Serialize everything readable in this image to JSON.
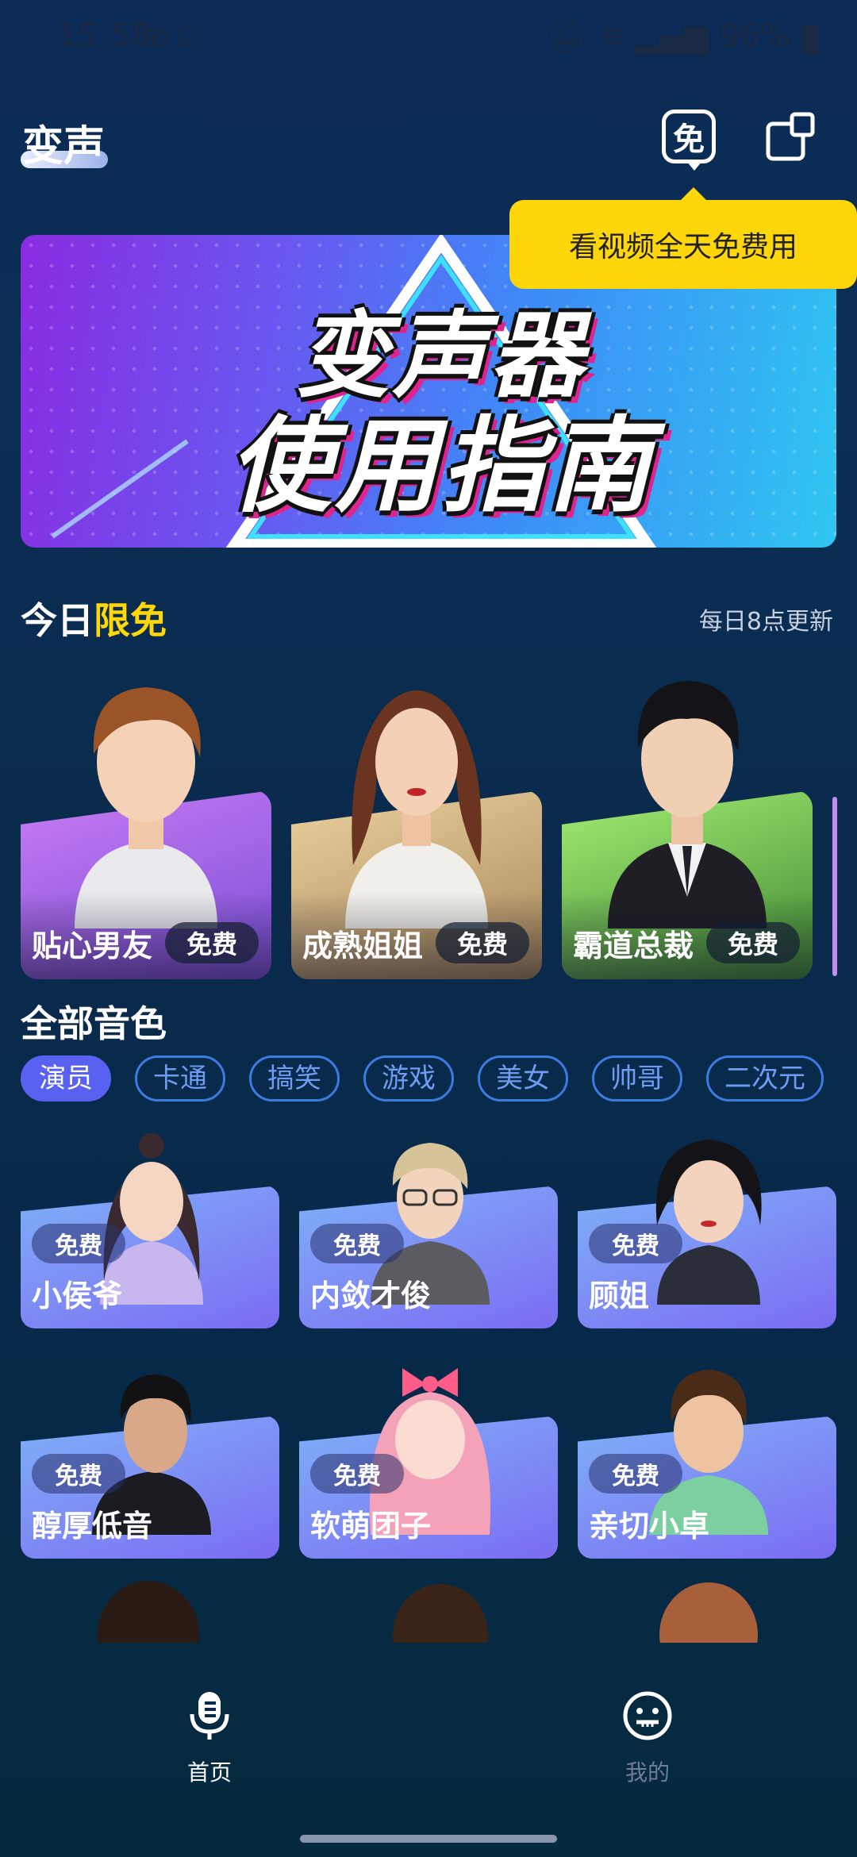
{
  "status_bar": {
    "time": "15:58",
    "battery": "96%",
    "left_icons": [
      "phone-wifi-call-icon",
      "check-box-icon"
    ],
    "right_icons": [
      "mute-icon",
      "wifi-icon",
      "signal-icon",
      "battery-icon"
    ]
  },
  "header": {
    "title": "变声",
    "free_button_label": "免",
    "window_icon": "floating-window-icon"
  },
  "tooltip": {
    "text": "看视频全天免费用"
  },
  "banner": {
    "line1": "变声器",
    "line2": "使用指南"
  },
  "today_section": {
    "title_plain": "今日",
    "title_highlight": "限免",
    "note": "每日8点更新",
    "cards": [
      {
        "name": "贴心男友",
        "badge": "免费",
        "colors": [
          "#b070f0",
          "#7a4fd8"
        ]
      },
      {
        "name": "成熟姐姐",
        "badge": "免费",
        "colors": [
          "#e8c99a",
          "#b89260"
        ]
      },
      {
        "name": "霸道总裁",
        "badge": "免费",
        "colors": [
          "#9ae870",
          "#4f9a3a"
        ]
      }
    ]
  },
  "all_section": {
    "title": "全部音色",
    "chips": [
      "演员",
      "卡通",
      "搞笑",
      "游戏",
      "美女",
      "帅哥",
      "二次元"
    ],
    "active_chip": "演员",
    "voices": [
      {
        "name": "小侯爷",
        "badge": "免费"
      },
      {
        "name": "内敛才俊",
        "badge": "免费"
      },
      {
        "name": "顾姐",
        "badge": "免费"
      },
      {
        "name": "醇厚低音",
        "badge": "免费"
      },
      {
        "name": "软萌团子",
        "badge": "免费"
      },
      {
        "name": "亲切小卓",
        "badge": "免费"
      }
    ]
  },
  "bottom_nav": {
    "items": [
      {
        "label": "首页",
        "icon": "microphone-icon",
        "active": true
      },
      {
        "label": "我的",
        "icon": "smiley-face-icon",
        "active": false
      }
    ]
  },
  "colors": {
    "accent_yellow": "#ffd60a",
    "chip_active": "#5861f0",
    "chip_border": "#3c7be0"
  }
}
